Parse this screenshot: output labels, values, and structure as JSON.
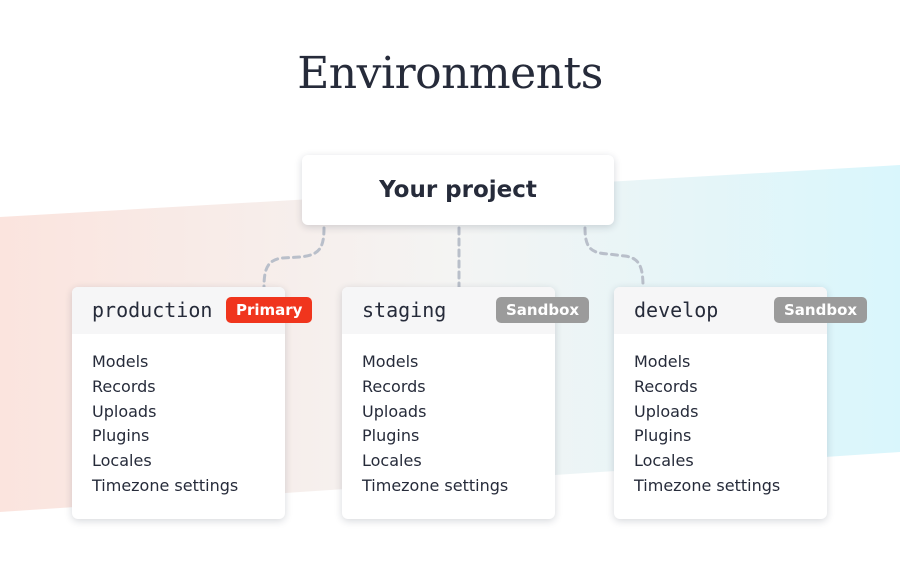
{
  "title": "Environments",
  "project": {
    "label": "Your project"
  },
  "environments": [
    {
      "name": "production",
      "badge": "Primary",
      "items": [
        "Models",
        "Records",
        "Uploads",
        "Plugins",
        "Locales",
        "Timezone settings"
      ]
    },
    {
      "name": "staging",
      "badge": "Sandbox",
      "items": [
        "Models",
        "Records",
        "Uploads",
        "Plugins",
        "Locales",
        "Timezone settings"
      ]
    },
    {
      "name": "develop",
      "badge": "Sandbox",
      "items": [
        "Models",
        "Records",
        "Uploads",
        "Plugins",
        "Locales",
        "Timezone settings"
      ]
    }
  ],
  "colors": {
    "primary_badge": "#f0351d",
    "sandbox_badge": "#9b9b9b",
    "band_left": "#fbe5df",
    "band_right": "#d8f5fb",
    "connector": "#b9bfca"
  }
}
